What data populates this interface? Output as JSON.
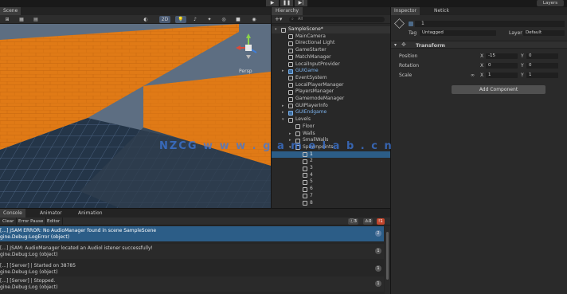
{
  "toolbar": {
    "play_icon": "play-icon",
    "pause_icon": "pause-icon",
    "step_icon": "step-icon",
    "layers_label": "Layers"
  },
  "scene": {
    "tab_label": "Scene",
    "perspective_label": "Persp",
    "toolbar_icons": [
      "globe-icon",
      "tool-handle-icon",
      "grid-icon",
      "snap-icon",
      "shading-icon",
      "2d-label",
      "light-icon",
      "audio-icon",
      "effects-icon",
      "hidden-icon",
      "camera-icon",
      "gizmo-icon"
    ],
    "two_d_label": "2D"
  },
  "hierarchy": {
    "tab_label": "Hierarchy",
    "search_placeholder": "All",
    "items": [
      {
        "label": "SampleScene*",
        "depth": 0,
        "expanded": true,
        "type": "scene"
      },
      {
        "label": "MainCamera",
        "depth": 1,
        "type": "object"
      },
      {
        "label": "Directional Light",
        "depth": 1,
        "type": "object"
      },
      {
        "label": "GameStarter",
        "depth": 1,
        "type": "object"
      },
      {
        "label": "MatchManager",
        "depth": 1,
        "type": "object"
      },
      {
        "label": "LocalInputProvider",
        "depth": 1,
        "type": "object"
      },
      {
        "label": "GUIGame",
        "depth": 1,
        "type": "prefab",
        "expandable": true
      },
      {
        "label": "EventSystem",
        "depth": 1,
        "type": "object"
      },
      {
        "label": "LocalPlayerManager",
        "depth": 1,
        "type": "object"
      },
      {
        "label": "PlayersManager",
        "depth": 1,
        "type": "object"
      },
      {
        "label": "GamemodeManager",
        "depth": 1,
        "type": "object"
      },
      {
        "label": "GUIPlayerInfo",
        "depth": 1,
        "type": "object",
        "expandable": true
      },
      {
        "label": "GUIEndgame",
        "depth": 1,
        "type": "prefab",
        "expandable": true
      },
      {
        "label": "Levels",
        "depth": 1,
        "type": "object",
        "expanded": true
      },
      {
        "label": "Floor",
        "depth": 2,
        "type": "object"
      },
      {
        "label": "Walls",
        "depth": 2,
        "type": "object",
        "expandable": true
      },
      {
        "label": "SmallWalls",
        "depth": 2,
        "type": "object",
        "expandable": true
      },
      {
        "label": "Spawnpoints",
        "depth": 2,
        "type": "object",
        "expanded": true
      },
      {
        "label": "1",
        "depth": 3,
        "type": "object",
        "selected": true
      },
      {
        "label": "2",
        "depth": 3,
        "type": "object"
      },
      {
        "label": "3",
        "depth": 3,
        "type": "object"
      },
      {
        "label": "4",
        "depth": 3,
        "type": "object"
      },
      {
        "label": "5",
        "depth": 3,
        "type": "object"
      },
      {
        "label": "6",
        "depth": 3,
        "type": "object"
      },
      {
        "label": "7",
        "depth": 3,
        "type": "object"
      },
      {
        "label": "8",
        "depth": 3,
        "type": "object"
      }
    ]
  },
  "inspector": {
    "tab_label": "Inspector",
    "network_tab_label": "Netick",
    "object_name": "1",
    "tag_label": "Tag",
    "tag_value": "Untagged",
    "layer_label": "Layer",
    "layer_value": "Default",
    "component_name": "Transform",
    "position_label": "Position",
    "rotation_label": "Rotation",
    "scale_label": "Scale",
    "position": {
      "x": "-15",
      "y": "0"
    },
    "rotation": {
      "x": "0",
      "y": "0"
    },
    "scale": {
      "x": "1",
      "y": "1"
    },
    "add_component_label": "Add Component"
  },
  "console": {
    "tabs": [
      "Console",
      "Animator",
      "Animation"
    ],
    "tools": [
      "Clear",
      "Error Pause",
      "Editor"
    ],
    "counts": {
      "log": "3",
      "warn": "0",
      "error": "1"
    },
    "logs": [
      {
        "line1": "[...] JSAM ERROR: No AudioManager found in scene SampleScene",
        "line2": "gine.Debug:LogError (object)",
        "count": "2",
        "selected": true
      },
      {
        "line1": "[...] JSAM: AudioManager located an Audiol istener successfully!",
        "line2": "gine.Debug:Log (object)",
        "count": "1"
      },
      {
        "line1": "[...] [Server] | Started on 38785",
        "line2": "gine.Debug:Log (object)",
        "count": "1"
      },
      {
        "line1": "[...] [Server] | Stopped.",
        "line2": "gine.Debug:Log (object)",
        "count": "1"
      }
    ]
  },
  "watermark": "NZCG  w w w . g a m e l a b . c n",
  "colors": {
    "wall_orange": "#e07a16",
    "floor_grid": "#243548",
    "selection_blue": "#2c5d87",
    "prefab_blue": "#7cb2ec"
  }
}
